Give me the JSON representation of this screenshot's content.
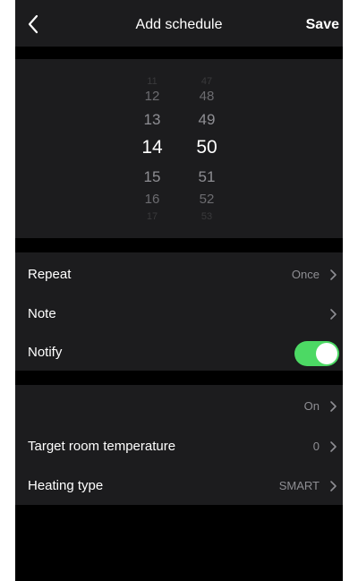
{
  "header": {
    "back_icon": "chevron-left-icon",
    "title": "Add schedule",
    "save_label": "Save"
  },
  "time_picker": {
    "hours": [
      "11",
      "12",
      "13",
      "14",
      "15",
      "16",
      "17"
    ],
    "minutes": [
      "47",
      "48",
      "49",
      "50",
      "51",
      "52",
      "53"
    ],
    "selected_hour": "14",
    "selected_minute": "50"
  },
  "settings": {
    "repeat": {
      "label": "Repeat",
      "value": "Once"
    },
    "note": {
      "label": "Note",
      "value": ""
    },
    "notify": {
      "label": "Notify",
      "enabled": true
    }
  },
  "heating": {
    "power": {
      "label": "",
      "value": "On"
    },
    "target_temp": {
      "label": "Target room temperature",
      "value": "0"
    },
    "heating_type": {
      "label": "Heating type",
      "value": "SMART"
    }
  },
  "colors": {
    "background": "#000000",
    "panel": "#1c1c1e",
    "toggle_on": "#4cd964",
    "secondary_text": "#8e8e93"
  }
}
